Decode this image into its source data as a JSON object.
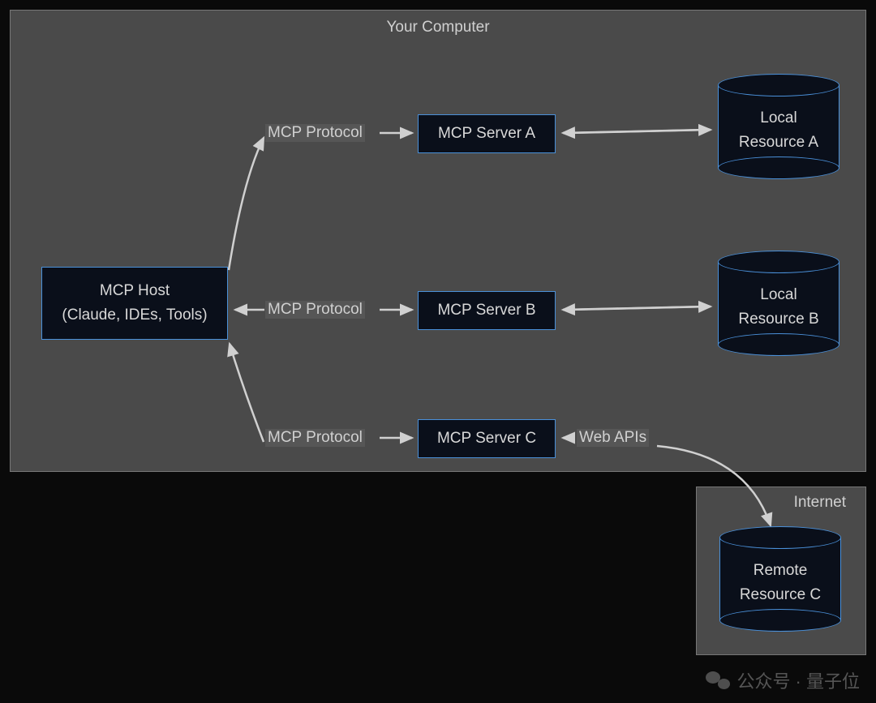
{
  "container_title": "Your Computer",
  "host": {
    "line1": "MCP Host",
    "line2": "(Claude, IDEs, Tools)"
  },
  "servers": {
    "a": "MCP Server A",
    "b": "MCP Server B",
    "c": "MCP Server C"
  },
  "resources": {
    "a": {
      "line1": "Local",
      "line2": "Resource A"
    },
    "b": {
      "line1": "Local",
      "line2": "Resource B"
    },
    "c": {
      "line1": "Remote",
      "line2": "Resource C"
    }
  },
  "edges": {
    "protocol_a": "MCP Protocol",
    "protocol_b": "MCP Protocol",
    "protocol_c": "MCP Protocol",
    "webapis": "Web APIs"
  },
  "internet_title": "Internet",
  "watermark": "公众号 · 量子位"
}
